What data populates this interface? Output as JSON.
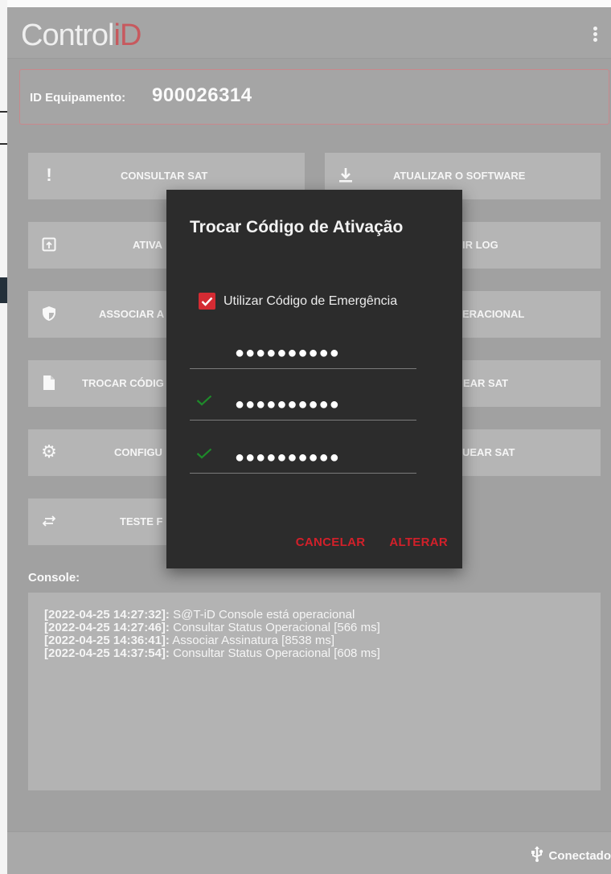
{
  "app": {
    "logo_main": "Control",
    "logo_accent": "iD"
  },
  "device": {
    "id_label": "ID Equipamento:",
    "id_value": "900026314"
  },
  "buttons": {
    "consultar_sat": "CONSULTAR SAT",
    "atualizar_software": "ATUALIZAR O SOFTWARE",
    "ativar": "ATIVA",
    "extrair_log": "IR LOG",
    "associar": "ASSOCIAR A",
    "status_operacional": "ERACIONAL",
    "trocar_codigo": "TROCAR CÓDIG",
    "bloquear_sat": "EAR SAT",
    "configurar": "CONFIGU",
    "desbloquear_sat": "UEAR SAT",
    "teste": "TESTE F"
  },
  "console": {
    "title": "Console:",
    "lines": [
      {
        "time": "[2022-04-25 14:27:32]:",
        "msg": " S@T-iD Console está operacional"
      },
      {
        "time": "[2022-04-25 14:27:46]:",
        "msg": " Consultar Status Operacional [566 ms]"
      },
      {
        "time": "[2022-04-25 14:36:41]:",
        "msg": " Associar Assinatura [8538 ms]"
      },
      {
        "time": "[2022-04-25 14:37:54]:",
        "msg": " Consultar Status Operacional [608 ms]"
      }
    ]
  },
  "footer": {
    "status": "Conectado"
  },
  "dialog": {
    "title": "Trocar Código de Ativação",
    "checkbox_label": "Utilizar Código de Emergência",
    "checkbox_checked": true,
    "field_current": "●●●●●●●●●●",
    "field_new": "●●●●●●●●●●",
    "field_confirm": "●●●●●●●●●●",
    "cancel_label": "CANCELAR",
    "confirm_label": "ALTERAR"
  },
  "colors": {
    "accent_red": "#d42b33",
    "valid_green": "#1e8a2a",
    "dialog_bg": "#2c2c2c"
  }
}
